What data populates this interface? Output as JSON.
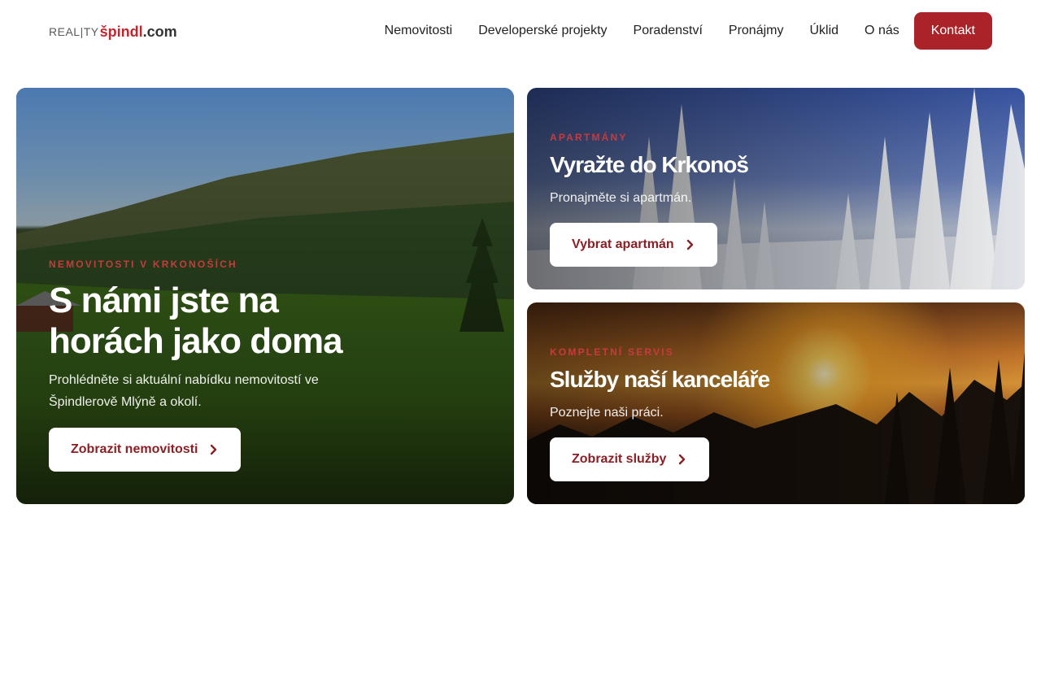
{
  "header": {
    "logo": {
      "part1": "REAL|TY",
      "part2": "špindl",
      "part3": ".com"
    },
    "nav": [
      {
        "label": "Nemovitosti"
      },
      {
        "label": "Developerské projekty"
      },
      {
        "label": "Poradenství"
      },
      {
        "label": "Pronájmy"
      },
      {
        "label": "Úklid"
      },
      {
        "label": "O nás"
      }
    ],
    "contact_label": "Kontakt",
    "accent_color": "#a92329"
  },
  "hero": {
    "eyebrow": "NEMOVITOSTI V KRKONOŠÍCH",
    "title_line1": "S námi jste na",
    "title_line2": "horách jako doma",
    "subtitle_line1": "Prohlédněte si aktuální nabídku nemovitostí ve",
    "subtitle_line2": "Špindlerově Mlýně a okolí.",
    "button_label": "Zobrazit nemovitosti",
    "button_icon": "chevron-right-icon"
  },
  "apartments": {
    "eyebrow": "APARTMÁNY",
    "title": "Vyražte do Krkonoš",
    "subtitle": "Pronajměte si apartmán.",
    "button_label": "Vybrat apartmán",
    "button_icon": "chevron-right-icon"
  },
  "services": {
    "eyebrow": "KOMPLETNÍ SERVIS",
    "title": "Služby naší kanceláře",
    "subtitle": "Poznejte naši práci.",
    "button_label": "Zobrazit služby",
    "button_icon": "chevron-right-icon"
  }
}
